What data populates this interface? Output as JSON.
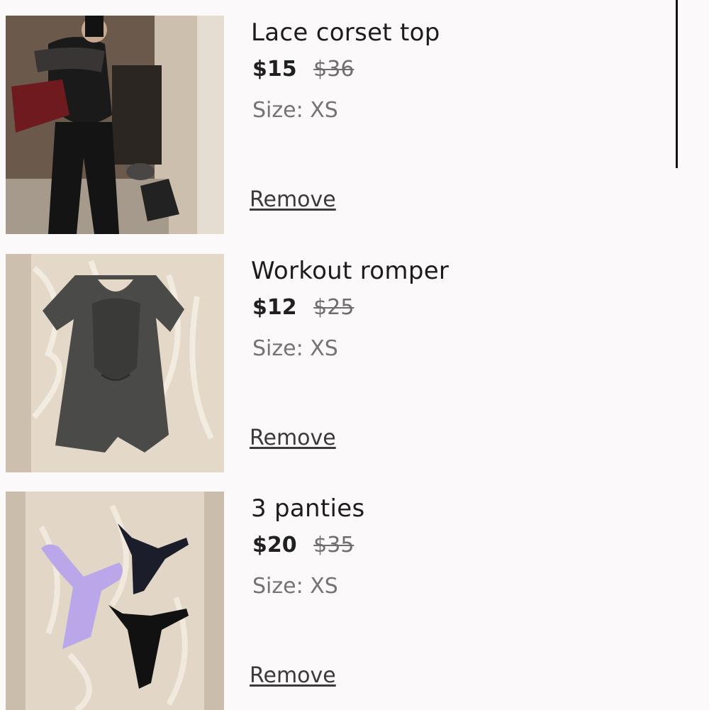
{
  "cart": {
    "items": [
      {
        "title": "Lace corset top",
        "price": "$15",
        "original_price": "$36",
        "size": "Size: XS",
        "remove_label": "Remove",
        "image_icon": "product-photo-corset"
      },
      {
        "title": "Workout romper",
        "price": "$12",
        "original_price": "$25",
        "size": "Size: XS",
        "remove_label": "Remove",
        "image_icon": "product-photo-romper"
      },
      {
        "title": "3 panties",
        "price": "$20",
        "original_price": "$35",
        "size": "Size: XS",
        "remove_label": "Remove",
        "image_icon": "product-photo-panties"
      }
    ]
  },
  "colors": {
    "background": "#fbf9fa",
    "text": "#1c1c1c",
    "muted": "#747474"
  }
}
